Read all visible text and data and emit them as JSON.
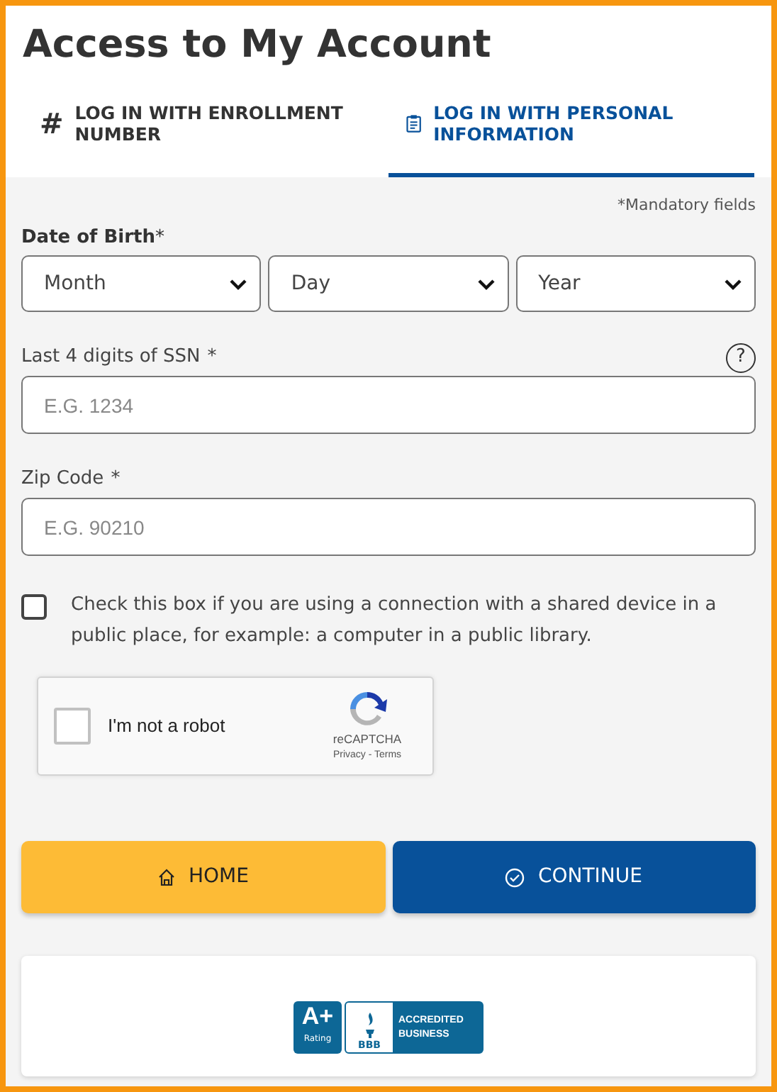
{
  "title": "Access to My Account",
  "tabs": [
    {
      "icon": "#",
      "label": "LOG IN WITH ENROLLMENT NUMBER",
      "selected": false
    },
    {
      "label": "LOG IN WITH PERSONAL INFORMATION",
      "selected": true
    }
  ],
  "mandatory_note": "*Mandatory fields",
  "date_of_birth": {
    "label": "Date of Birth",
    "mark": "*",
    "selects": [
      {
        "value": "Month"
      },
      {
        "value": "Day"
      },
      {
        "value": "Year"
      }
    ]
  },
  "fields": [
    {
      "label": "Last 4 digits of SSN",
      "mark": "*",
      "placeholder": "E.G. 1234",
      "help": "?"
    },
    {
      "label": "Zip Code",
      "mark": "*",
      "placeholder": "E.G. 90210"
    }
  ],
  "shared_device": {
    "checked": false,
    "text": "Check this box if you are using a connection with a shared device in a public place, for example: a computer in a public library."
  },
  "captcha": {
    "checked": false,
    "label": "I'm not a robot",
    "brand": "reCAPTCHA",
    "links": "Privacy - Terms"
  },
  "buttons": [
    {
      "kind": "secondary",
      "label": "HOME"
    },
    {
      "kind": "primary",
      "label": "CONTINUE"
    }
  ],
  "badge": {
    "grade": "A+",
    "grade_caption": "Rating",
    "org": "BBB",
    "line1": "ACCREDITED",
    "line2": "BUSINESS"
  }
}
